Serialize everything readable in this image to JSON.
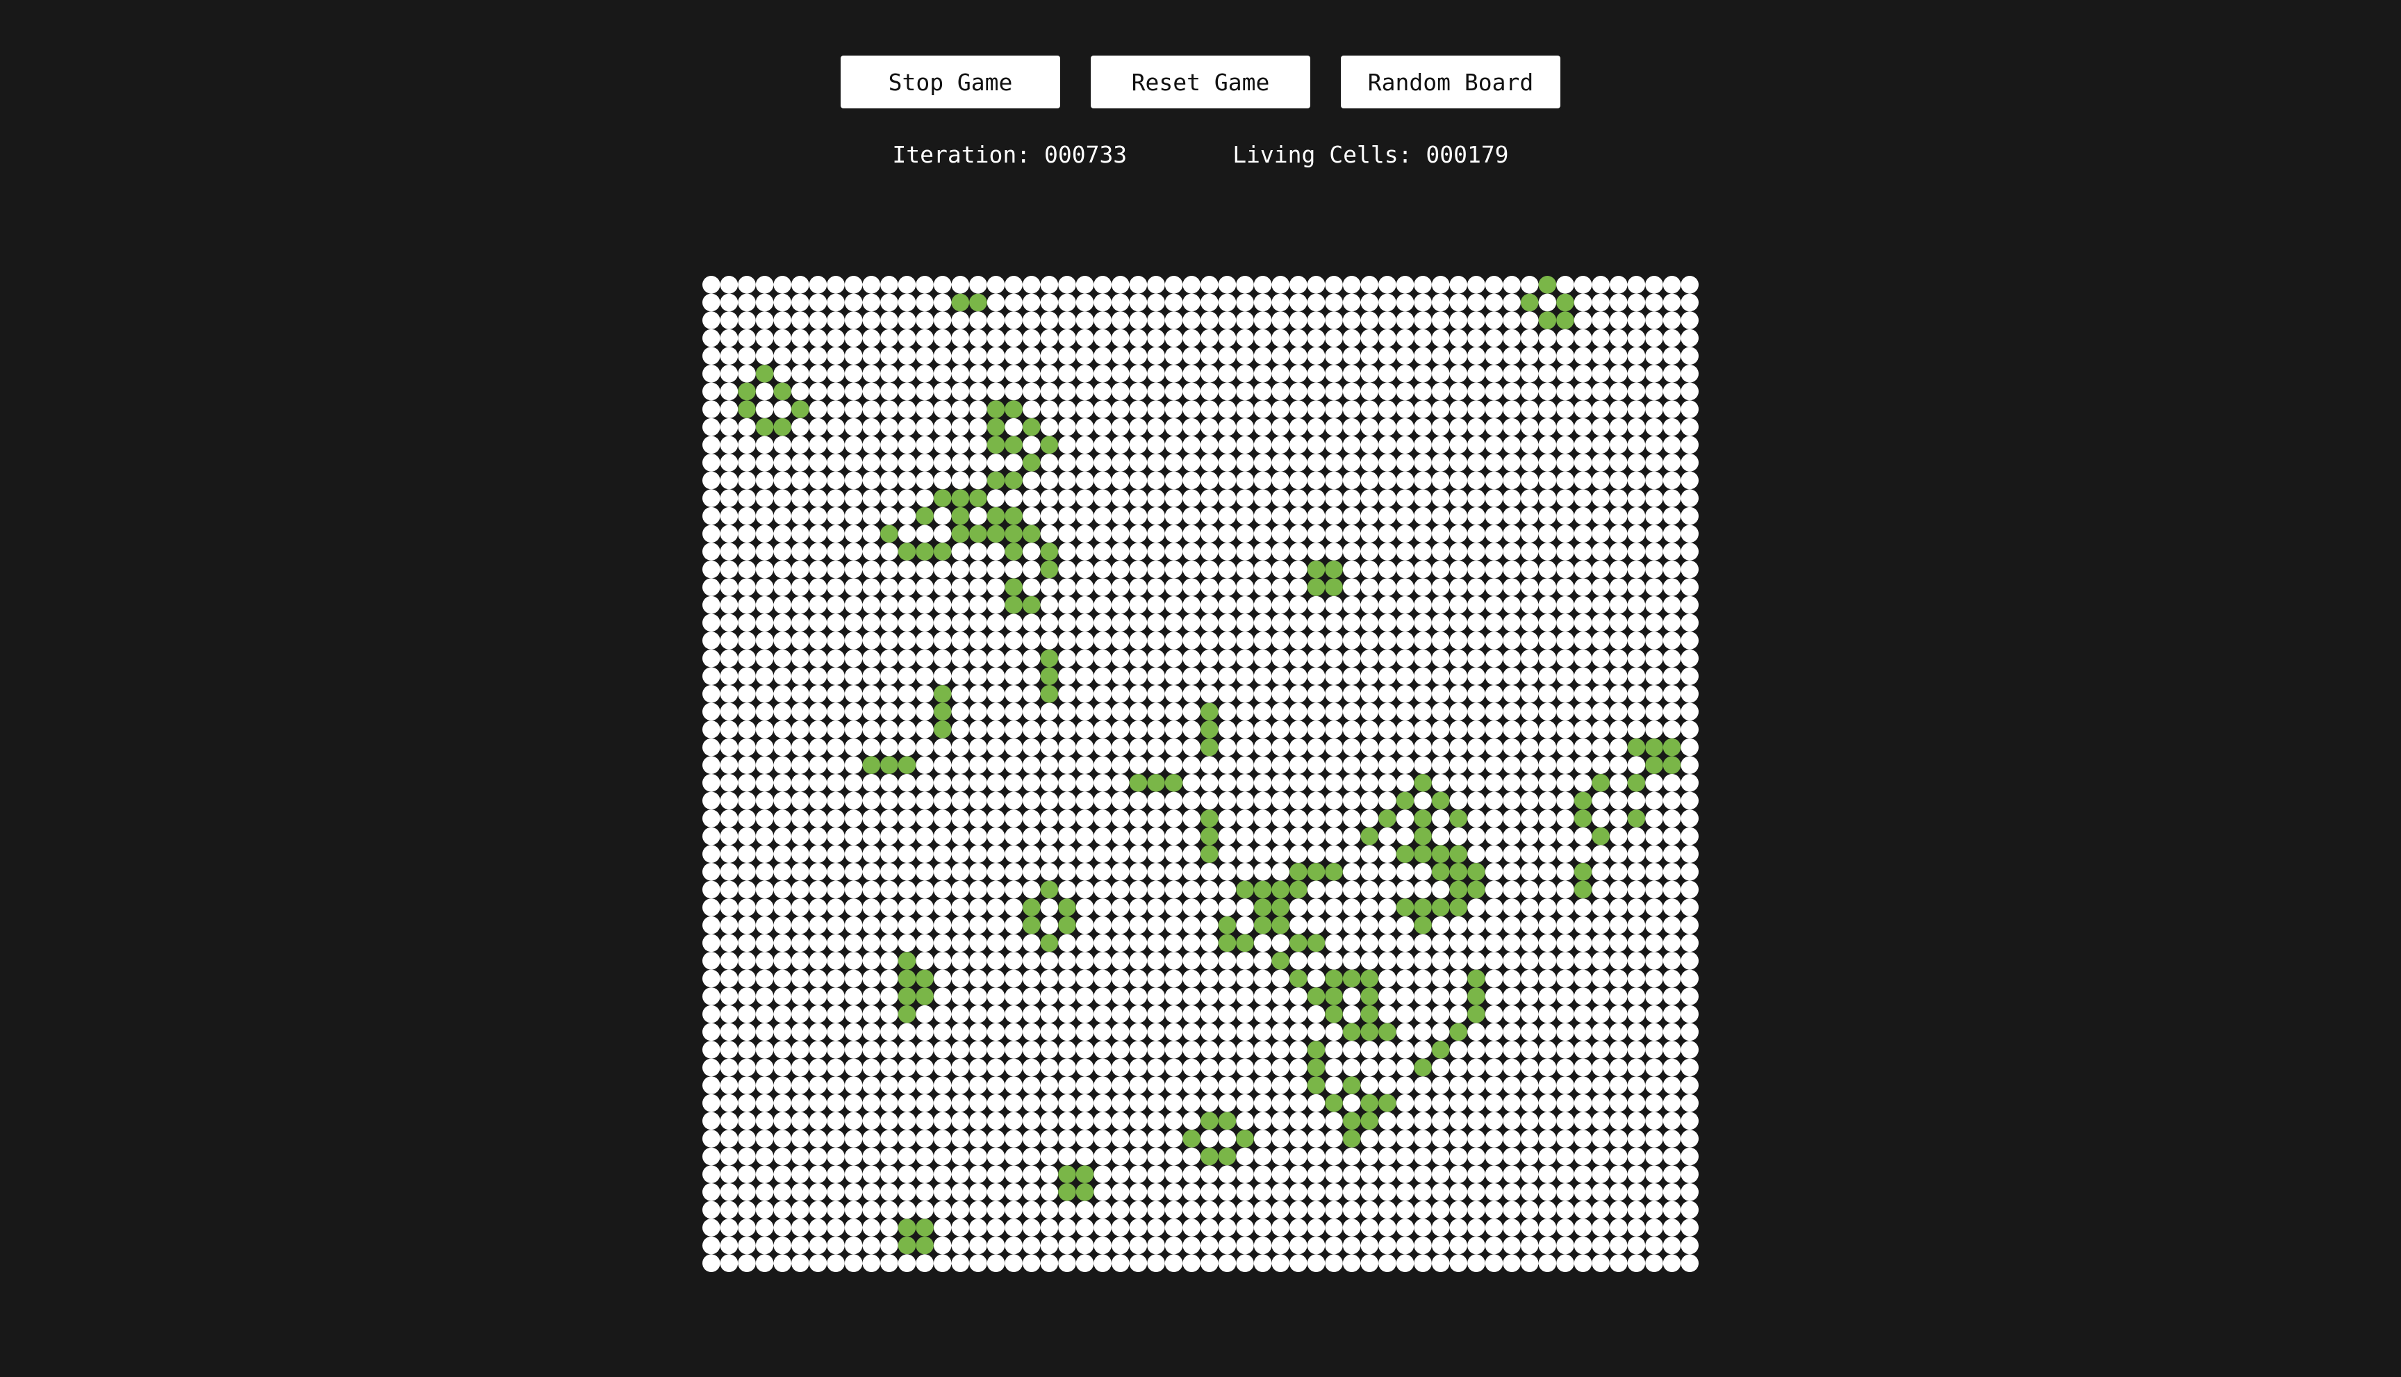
{
  "buttons": {
    "stop": "Stop Game",
    "reset": "Reset Game",
    "random": "Random Board"
  },
  "stats": {
    "iteration_label": "Iteration: ",
    "iteration_value": "000733",
    "living_label": "Living Cells: ",
    "living_value": "000179"
  },
  "board": {
    "rows": 56,
    "cols": 56,
    "colors": {
      "background": "#181818",
      "dead": "#ffffff",
      "alive": "#7ab648"
    },
    "alive_cells": [
      [
        1,
        14
      ],
      [
        1,
        15
      ],
      [
        0,
        47
      ],
      [
        1,
        46
      ],
      [
        1,
        48
      ],
      [
        2,
        47
      ],
      [
        2,
        48
      ],
      [
        5,
        3
      ],
      [
        6,
        2
      ],
      [
        6,
        4
      ],
      [
        7,
        2
      ],
      [
        7,
        5
      ],
      [
        8,
        3
      ],
      [
        8,
        4
      ],
      [
        7,
        16
      ],
      [
        7,
        17
      ],
      [
        8,
        16
      ],
      [
        8,
        18
      ],
      [
        9,
        16
      ],
      [
        9,
        17
      ],
      [
        9,
        19
      ],
      [
        10,
        18
      ],
      [
        11,
        16
      ],
      [
        11,
        17
      ],
      [
        12,
        13
      ],
      [
        12,
        14
      ],
      [
        12,
        15
      ],
      [
        13,
        12
      ],
      [
        13,
        14
      ],
      [
        13,
        16
      ],
      [
        13,
        17
      ],
      [
        14,
        10
      ],
      [
        14,
        14
      ],
      [
        14,
        15
      ],
      [
        14,
        16
      ],
      [
        14,
        17
      ],
      [
        14,
        18
      ],
      [
        15,
        11
      ],
      [
        15,
        12
      ],
      [
        15,
        13
      ],
      [
        15,
        17
      ],
      [
        15,
        19
      ],
      [
        16,
        19
      ],
      [
        16,
        34
      ],
      [
        16,
        35
      ],
      [
        17,
        17
      ],
      [
        17,
        34
      ],
      [
        17,
        35
      ],
      [
        18,
        17
      ],
      [
        18,
        18
      ],
      [
        21,
        19
      ],
      [
        22,
        19
      ],
      [
        23,
        19
      ],
      [
        23,
        13
      ],
      [
        24,
        13
      ],
      [
        25,
        13
      ],
      [
        24,
        28
      ],
      [
        25,
        28
      ],
      [
        26,
        28
      ],
      [
        27,
        9
      ],
      [
        27,
        10
      ],
      [
        27,
        11
      ],
      [
        26,
        52
      ],
      [
        26,
        53
      ],
      [
        26,
        54
      ],
      [
        27,
        54
      ],
      [
        27,
        53
      ],
      [
        28,
        52
      ],
      [
        28,
        24
      ],
      [
        28,
        25
      ],
      [
        28,
        26
      ],
      [
        28,
        40
      ],
      [
        28,
        50
      ],
      [
        29,
        39
      ],
      [
        29,
        41
      ],
      [
        29,
        49
      ],
      [
        30,
        38
      ],
      [
        30,
        40
      ],
      [
        30,
        42
      ],
      [
        30,
        49
      ],
      [
        30,
        52
      ],
      [
        30,
        28
      ],
      [
        31,
        28
      ],
      [
        32,
        28
      ],
      [
        31,
        50
      ],
      [
        31,
        40
      ],
      [
        32,
        40
      ],
      [
        32,
        41
      ],
      [
        31,
        37
      ],
      [
        32,
        39
      ],
      [
        32,
        42
      ],
      [
        33,
        41
      ],
      [
        33,
        43
      ],
      [
        33,
        42
      ],
      [
        33,
        33
      ],
      [
        33,
        34
      ],
      [
        33,
        35
      ],
      [
        34,
        30
      ],
      [
        34,
        31
      ],
      [
        34,
        32
      ],
      [
        34,
        33
      ],
      [
        34,
        43
      ],
      [
        34,
        42
      ],
      [
        34,
        49
      ],
      [
        33,
        49
      ],
      [
        34,
        19
      ],
      [
        35,
        18
      ],
      [
        35,
        20
      ],
      [
        36,
        18
      ],
      [
        36,
        20
      ],
      [
        37,
        19
      ],
      [
        35,
        31
      ],
      [
        35,
        32
      ],
      [
        35,
        39
      ],
      [
        35,
        40
      ],
      [
        35,
        41
      ],
      [
        35,
        42
      ],
      [
        36,
        29
      ],
      [
        36,
        31
      ],
      [
        36,
        32
      ],
      [
        36,
        40
      ],
      [
        37,
        29
      ],
      [
        37,
        30
      ],
      [
        37,
        33
      ],
      [
        37,
        34
      ],
      [
        38,
        11
      ],
      [
        39,
        11
      ],
      [
        39,
        12
      ],
      [
        40,
        11
      ],
      [
        40,
        12
      ],
      [
        41,
        11
      ],
      [
        38,
        32
      ],
      [
        39,
        33
      ],
      [
        39,
        35
      ],
      [
        39,
        36
      ],
      [
        39,
        37
      ],
      [
        39,
        43
      ],
      [
        40,
        34
      ],
      [
        40,
        35
      ],
      [
        40,
        37
      ],
      [
        40,
        43
      ],
      [
        41,
        35
      ],
      [
        41,
        37
      ],
      [
        41,
        43
      ],
      [
        42,
        36
      ],
      [
        42,
        37
      ],
      [
        42,
        38
      ],
      [
        42,
        42
      ],
      [
        43,
        34
      ],
      [
        43,
        41
      ],
      [
        44,
        34
      ],
      [
        44,
        40
      ],
      [
        45,
        34
      ],
      [
        45,
        36
      ],
      [
        46,
        35
      ],
      [
        46,
        37
      ],
      [
        46,
        38
      ],
      [
        47,
        36
      ],
      [
        47,
        37
      ],
      [
        48,
        36
      ],
      [
        47,
        28
      ],
      [
        47,
        29
      ],
      [
        48,
        27
      ],
      [
        48,
        30
      ],
      [
        49,
        28
      ],
      [
        49,
        29
      ],
      [
        50,
        20
      ],
      [
        50,
        21
      ],
      [
        51,
        20
      ],
      [
        51,
        21
      ],
      [
        53,
        11
      ],
      [
        53,
        12
      ],
      [
        54,
        11
      ],
      [
        54,
        12
      ]
    ]
  }
}
